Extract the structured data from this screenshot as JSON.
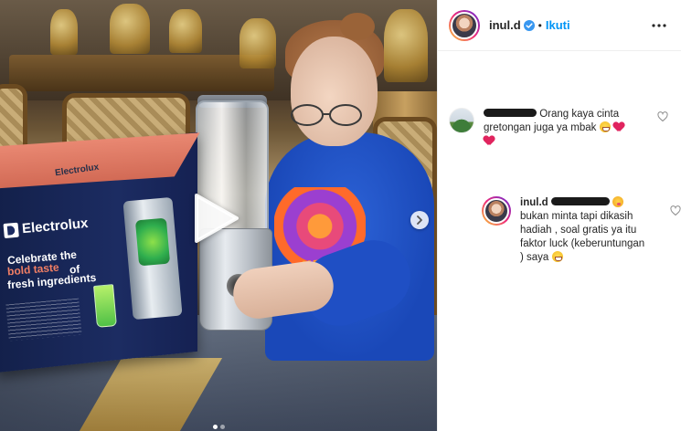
{
  "post": {
    "username": "inul.d",
    "separator": "•",
    "follow_label": "Ikuti"
  },
  "media": {
    "box_top_text": "Electrolux",
    "box_brand": "Electrolux",
    "box_tagline_lines": [
      "Celebrate the",
      "bold taste",
      "of",
      "fresh ingredients"
    ],
    "slides_count": 2,
    "active_slide": 1
  },
  "comments": [
    {
      "text": "Orang kaya cinta gretongan juga ya mbak",
      "emojis": [
        "grinning-sweat-emoji",
        "heart-emoji",
        "heart-emoji"
      ]
    },
    {
      "username": "inul.d",
      "text": "bukan minta tapi dikasih hadiah , soal gratis ya itu faktor luck (keberuntungan ) saya",
      "emojis": [
        "yum-emoji",
        "grinning-emoji"
      ]
    }
  ],
  "icons": {
    "verified": "verified-badge-icon",
    "more": "more-options-icon",
    "play": "play-icon",
    "next": "chevron-right-icon",
    "like": "heart-outline-icon"
  },
  "colors": {
    "accent_link": "#0095f6",
    "verified_blue": "#3897f0",
    "text_primary": "#262626"
  }
}
